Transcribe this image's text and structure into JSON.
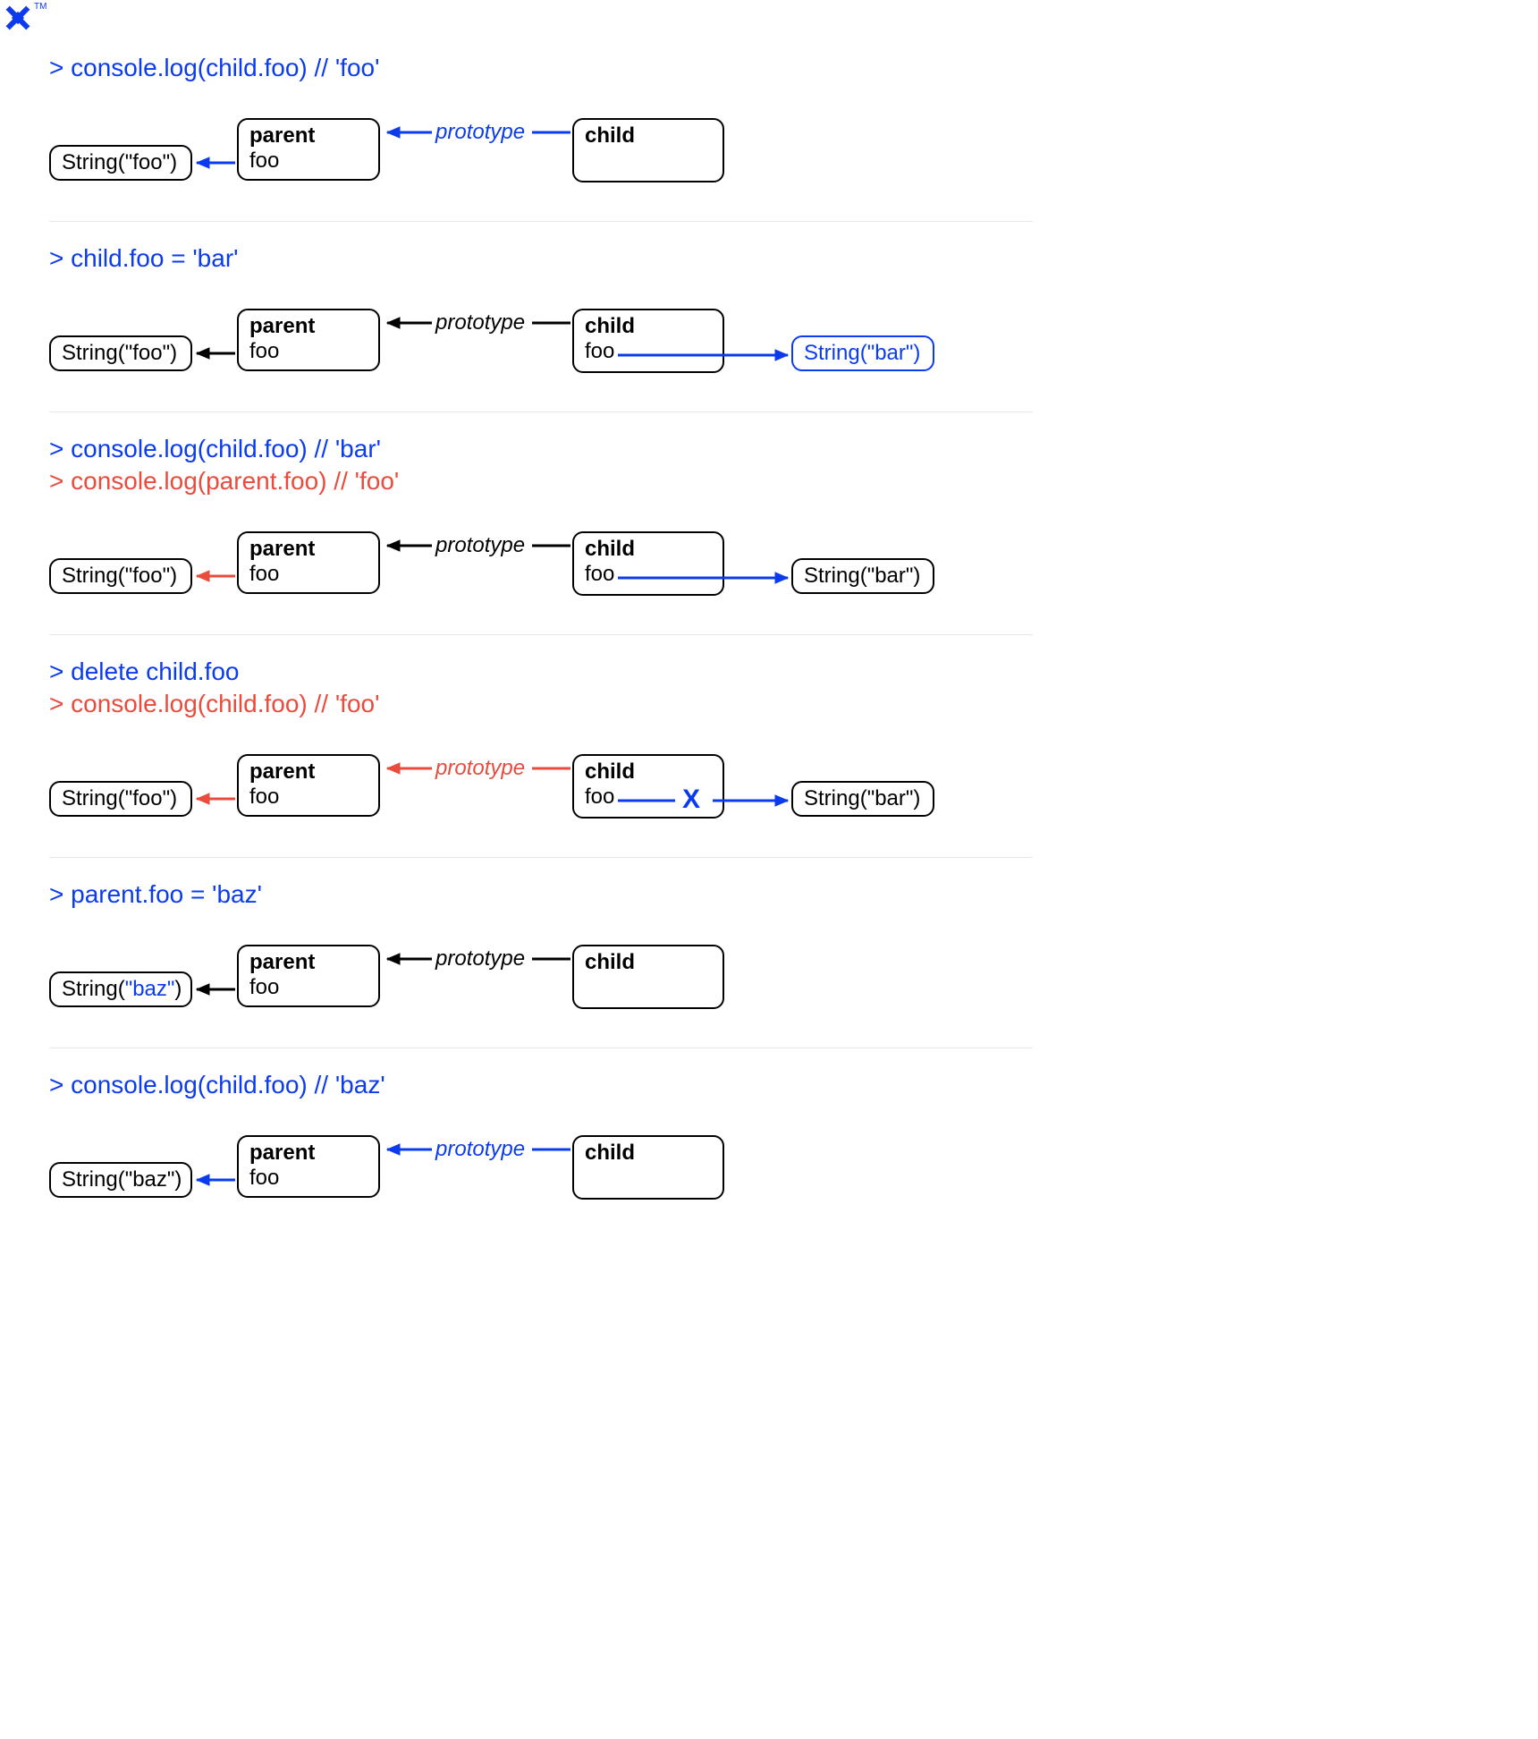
{
  "logo": {
    "tm": "TM"
  },
  "strings": {
    "foo": "String(\"foo\")",
    "bar": "String(\"bar\")",
    "baz": "String(\"baz\")",
    "baz_quoted": "\"baz\""
  },
  "labels": {
    "parent": "parent",
    "child": "child",
    "foo": "foo",
    "prototype": "prototype",
    "string_prefix": "String(",
    "string_suffix": ")"
  },
  "sections": [
    {
      "code": [
        {
          "color": "blue",
          "text": "> console.log(child.foo) // 'foo'"
        }
      ],
      "stringLeft": "foo",
      "stringRight": null,
      "childHasFoo": false,
      "arrowStrLeft": "blue",
      "arrowProto": "blue",
      "arrowStrRight": null,
      "protoColor": "blue",
      "deleted": false,
      "bazHighlight": false
    },
    {
      "code": [
        {
          "color": "blue",
          "text": "> child.foo = 'bar'"
        }
      ],
      "stringLeft": "foo",
      "stringRight": "bar",
      "childHasFoo": true,
      "arrowStrLeft": "black",
      "arrowProto": "black",
      "arrowStrRight": "blue",
      "protoColor": "black",
      "rightBoxBlue": true,
      "deleted": false,
      "bazHighlight": false
    },
    {
      "code": [
        {
          "color": "blue",
          "text": "> console.log(child.foo) // 'bar'"
        },
        {
          "color": "red",
          "text": "> console.log(parent.foo) // 'foo'"
        }
      ],
      "stringLeft": "foo",
      "stringRight": "bar",
      "childHasFoo": true,
      "arrowStrLeft": "red",
      "arrowProto": "black",
      "arrowStrRight": "blue",
      "protoColor": "black",
      "deleted": false,
      "bazHighlight": false
    },
    {
      "code": [
        {
          "color": "blue",
          "text": "> delete child.foo"
        },
        {
          "color": "red",
          "text": "> console.log(child.foo) // 'foo'"
        }
      ],
      "stringLeft": "foo",
      "stringRight": "bar",
      "childHasFoo": true,
      "arrowStrLeft": "red",
      "arrowProto": "red",
      "arrowStrRight": "blue",
      "protoColor": "red",
      "deleted": true,
      "bazHighlight": false
    },
    {
      "code": [
        {
          "color": "blue",
          "text": "> parent.foo = 'baz'"
        }
      ],
      "stringLeft": "baz",
      "stringRight": null,
      "childHasFoo": false,
      "arrowStrLeft": "black",
      "arrowProto": "black",
      "arrowStrRight": null,
      "protoColor": "black",
      "deleted": false,
      "bazHighlight": true
    },
    {
      "code": [
        {
          "color": "blue",
          "text": "> console.log(child.foo) // 'baz'"
        }
      ],
      "stringLeft": "baz",
      "stringRight": null,
      "childHasFoo": false,
      "arrowStrLeft": "blue",
      "arrowProto": "blue",
      "arrowStrRight": null,
      "protoColor": "blue",
      "deleted": false,
      "bazHighlight": false
    }
  ]
}
